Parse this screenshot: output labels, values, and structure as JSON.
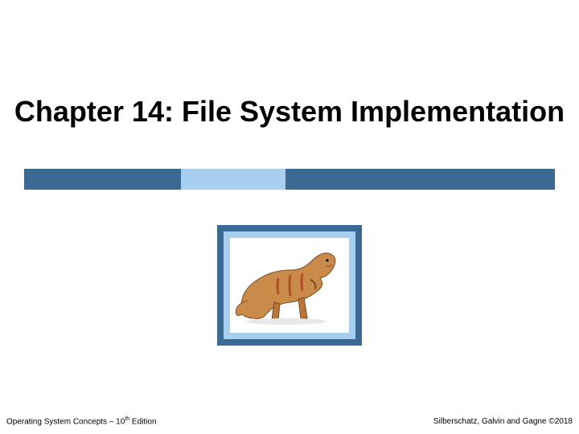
{
  "title": "Chapter 14:  File System Implementation",
  "footer": {
    "left_pre": "Operating System Concepts – 10",
    "left_sup": "th",
    "left_post": " Edition",
    "right": "Silberschatz, Galvin and Gagne ©2018"
  },
  "image": {
    "name": "dinosaur-illustration"
  }
}
